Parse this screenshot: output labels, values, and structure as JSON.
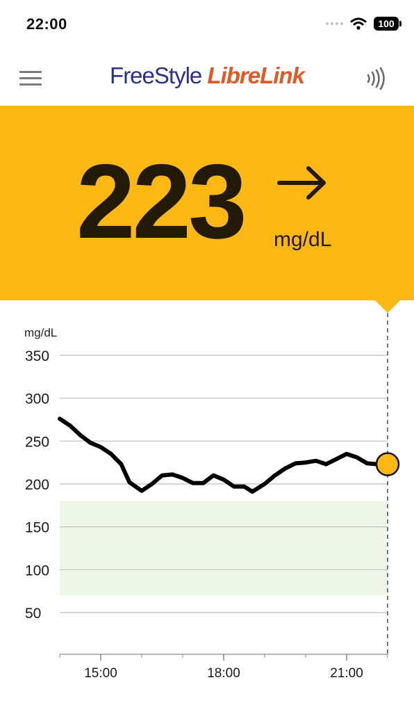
{
  "status_bar": {
    "time": "22:00",
    "battery": "100",
    "icons": [
      "cellular-signal-icon",
      "wifi-icon",
      "battery-icon"
    ]
  },
  "header": {
    "brand_part1": "FreeStyle",
    "brand_part2": "LibreLink",
    "menu_icon": "hamburger-menu-icon",
    "scan_icon": "nfc-scan-icon"
  },
  "reading": {
    "value": "223",
    "unit": "mg/dL",
    "trend": "steady",
    "trend_icon": "arrow-right-icon",
    "panel_color": "#fdb813"
  },
  "chart_data": {
    "type": "line",
    "ylabel": "mg/dL",
    "ylim": [
      0,
      350
    ],
    "yticks": [
      "350",
      "300",
      "250",
      "200",
      "150",
      "100",
      "50"
    ],
    "ytick_values": [
      350,
      300,
      250,
      200,
      150,
      100,
      50
    ],
    "xticks": [
      "15:00",
      "18:00",
      "21:00"
    ],
    "xtick_values": [
      15,
      18,
      21
    ],
    "xlim": [
      14,
      22
    ],
    "target_range": [
      70,
      180
    ],
    "grid": true,
    "line_color": "#000000",
    "target_color": "#eef6e8",
    "series": [
      {
        "x": [
          14.0,
          14.25,
          14.5,
          14.75,
          15.0,
          15.25,
          15.5,
          15.7,
          16.0,
          16.25,
          16.5,
          16.75,
          17.0,
          17.25,
          17.5,
          17.75,
          18.0,
          18.25,
          18.5,
          18.7,
          19.0,
          19.25,
          19.5,
          19.75,
          20.0,
          20.25,
          20.5,
          20.75,
          21.0,
          21.25,
          21.5,
          21.75
        ],
        "values": [
          276,
          268,
          257,
          248,
          243,
          235,
          223,
          202,
          192,
          200,
          210,
          211,
          207,
          201,
          201,
          210,
          205,
          197,
          197,
          191,
          200,
          210,
          218,
          224,
          225,
          227,
          223,
          229,
          235,
          231,
          224,
          223
        ]
      }
    ],
    "current": {
      "x": 22.0,
      "value": 223
    }
  }
}
